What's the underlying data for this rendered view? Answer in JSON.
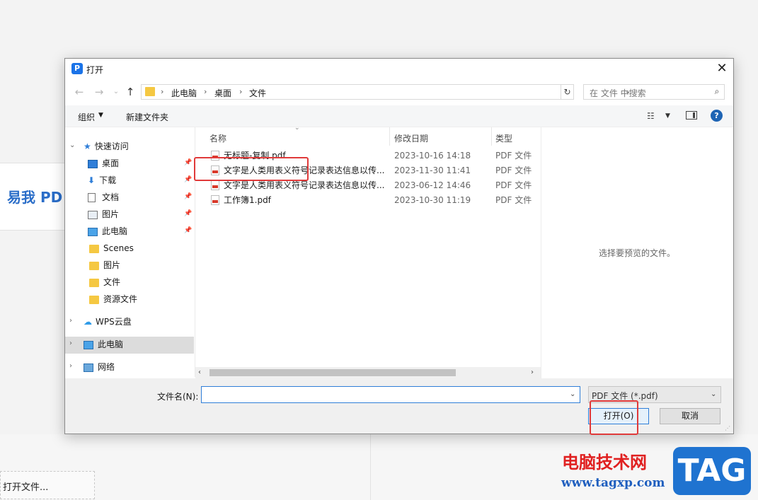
{
  "background_app": {
    "title": "易我 PD",
    "open_file_label": "打开文件..."
  },
  "dialog": {
    "title": "打开",
    "close_icon": "close-icon",
    "nav_buttons": [
      "←",
      "→",
      "⌄",
      "↑"
    ],
    "breadcrumb": [
      "此电脑",
      "桌面",
      "文件"
    ],
    "search_placeholder": "在 文件 中搜索",
    "toolbar": {
      "organize_label": "组织",
      "new_folder_label": "新建文件夹"
    },
    "nav_tree": [
      {
        "label": "快速访问",
        "icon": "star-icon",
        "expanded": true
      },
      {
        "label": "桌面",
        "icon": "desktop-icon",
        "pinned": true
      },
      {
        "label": "下载",
        "icon": "download-icon",
        "pinned": true
      },
      {
        "label": "文档",
        "icon": "document-icon",
        "pinned": true
      },
      {
        "label": "图片",
        "icon": "picture-icon",
        "pinned": true
      },
      {
        "label": "此电脑",
        "icon": "computer-icon",
        "pinned": true
      },
      {
        "label": "Scenes",
        "icon": "folder-icon"
      },
      {
        "label": "图片",
        "icon": "folder-icon"
      },
      {
        "label": "文件",
        "icon": "folder-icon"
      },
      {
        "label": "资源文件",
        "icon": "folder-icon"
      },
      {
        "label": "WPS云盘",
        "icon": "cloud-icon"
      },
      {
        "label": "此电脑",
        "icon": "computer-icon",
        "selected": true
      },
      {
        "label": "网络",
        "icon": "network-icon"
      }
    ],
    "columns": {
      "name": "名称",
      "date": "修改日期",
      "type": "类型"
    },
    "files": [
      {
        "name": "无标题-复制.pdf",
        "date": "2023-10-16 14:18",
        "type": "PDF 文件"
      },
      {
        "name": "文字是人类用表义符号记录表达信息以传...",
        "date": "2023-11-30 11:41",
        "type": "PDF 文件"
      },
      {
        "name": "文字是人类用表义符号记录表达信息以传...",
        "date": "2023-06-12 14:46",
        "type": "PDF 文件"
      },
      {
        "name": "工作簿1.pdf",
        "date": "2023-10-30 11:19",
        "type": "PDF 文件"
      }
    ],
    "preview_text": "选择要预览的文件。",
    "filename_label": "文件名(N):",
    "filename_value": "",
    "filetype_label": "PDF 文件 (*.pdf)",
    "open_button": "打开(O)",
    "cancel_button": "取消"
  },
  "watermark": {
    "site_name": "电脑技术网",
    "url": "www.tagxp.com",
    "tag": "TAG"
  },
  "colors": {
    "annotation_red": "#e03a3a",
    "accent_blue": "#2f7ed8"
  }
}
